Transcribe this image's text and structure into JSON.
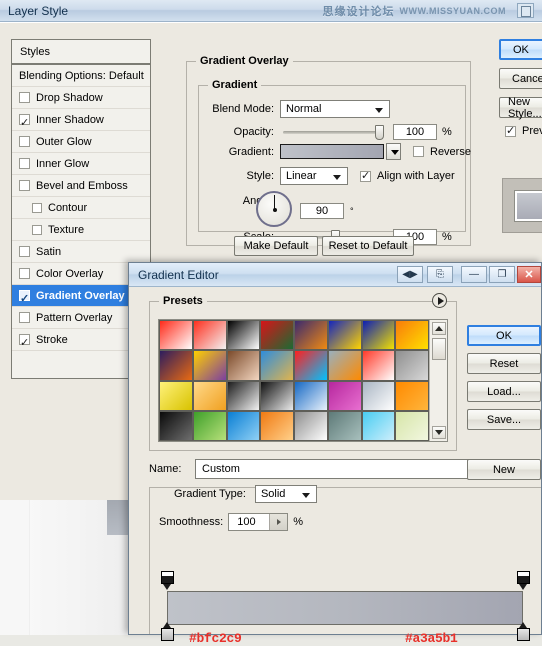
{
  "window": {
    "title": "Layer Style",
    "watermark_cn": "思缘设计论坛",
    "watermark_en": "WWW.MISSYUAN.COM",
    "watermark_icon": "window-icon"
  },
  "styles_panel": {
    "header": "Styles",
    "blending_options": "Blending Options: Default",
    "items": [
      {
        "label": "Drop Shadow",
        "checked": false,
        "indent": false,
        "selected": false
      },
      {
        "label": "Inner Shadow",
        "checked": true,
        "indent": false,
        "selected": false
      },
      {
        "label": "Outer Glow",
        "checked": false,
        "indent": false,
        "selected": false
      },
      {
        "label": "Inner Glow",
        "checked": false,
        "indent": false,
        "selected": false
      },
      {
        "label": "Bevel and Emboss",
        "checked": false,
        "indent": false,
        "selected": false
      },
      {
        "label": "Contour",
        "checked": false,
        "indent": true,
        "selected": false
      },
      {
        "label": "Texture",
        "checked": false,
        "indent": true,
        "selected": false
      },
      {
        "label": "Satin",
        "checked": false,
        "indent": false,
        "selected": false
      },
      {
        "label": "Color Overlay",
        "checked": false,
        "indent": false,
        "selected": false
      },
      {
        "label": "Gradient Overlay",
        "checked": true,
        "indent": false,
        "selected": true
      },
      {
        "label": "Pattern Overlay",
        "checked": false,
        "indent": false,
        "selected": false
      },
      {
        "label": "Stroke",
        "checked": true,
        "indent": false,
        "selected": false
      }
    ]
  },
  "gradient_overlay": {
    "section_title": "Gradient Overlay",
    "group_title": "Gradient",
    "blend_mode_label": "Blend Mode:",
    "blend_mode_value": "Normal",
    "opacity_label": "Opacity:",
    "opacity_value": "100",
    "opacity_unit": "%",
    "gradient_label": "Gradient:",
    "gradient_start": "#bfc2c9",
    "gradient_end": "#a3a5b1",
    "reverse_label": "Reverse",
    "reverse_checked": false,
    "style_label": "Style:",
    "style_value": "Linear",
    "align_label": "Align with Layer",
    "align_checked": true,
    "angle_label": "Angle:",
    "angle_value": "90",
    "angle_unit": "°",
    "scale_label": "Scale:",
    "scale_value": "100",
    "scale_unit": "%",
    "make_default": "Make Default",
    "reset_to_default": "Reset to Default"
  },
  "layer_style_buttons": {
    "ok": "OK",
    "cancel": "Cancel",
    "new_style": "New Style...",
    "preview_label": "Preview",
    "preview_checked": true
  },
  "gradient_editor": {
    "title": "Gradient Editor",
    "controls": {
      "nav": "arrows-icon",
      "restore": "restore-icon",
      "minimize": "minimize-icon",
      "maximize": "maximize-icon",
      "close": "close-icon"
    },
    "presets_label": "Presets",
    "presets_menu": "presets-menu-icon",
    "presets": [
      [
        "#ff2a19",
        "#ffffff"
      ],
      [
        "#ff2f1e",
        "#f2f2f2"
      ],
      [
        "#000000",
        "#ffffff"
      ],
      [
        "#d81418",
        "#1b6b33"
      ],
      [
        "#3b2a6e",
        "#f08a12"
      ],
      [
        "#1526bd",
        "#ffd400"
      ],
      [
        "#0d1fb5",
        "#f2e000"
      ],
      [
        "#f97c0a",
        "#ffe000"
      ],
      [
        "#2d1d5e",
        "#e86a12"
      ],
      [
        "#ffd000",
        "#7c3fa0"
      ],
      [
        "#7b4a2a",
        "#f3d6c0"
      ],
      [
        "#2e8ddd",
        "#e0b44e"
      ],
      [
        "#ff1f1f",
        "#00c2ff"
      ],
      [
        "#9ab0bd",
        "#ff8a00"
      ],
      [
        "#ff3a2a",
        "#ffffff"
      ],
      [
        "#8f8f8f",
        "#d8d8d8"
      ],
      [
        "#fff27a",
        "#d8c200"
      ],
      [
        "#ffd98a",
        "#f0a020"
      ],
      [
        "#1d1d1d",
        "#f2f2f2"
      ],
      [
        "#111111",
        "#eaeaea"
      ],
      [
        "#1769c4",
        "#e8f1fb"
      ],
      [
        "#b6279e",
        "#e86fd0"
      ],
      [
        "#aab6c4",
        "#ffffff"
      ],
      [
        "#ff8a00",
        "#ffb53c"
      ],
      [
        "#0a0a0a",
        "#6e6e6e"
      ],
      [
        "#3fa02a",
        "#b7e07a"
      ],
      [
        "#0a7fd4",
        "#8fd0f5"
      ],
      [
        "#f07a12",
        "#ffd08a"
      ],
      [
        "#8e8e8e",
        "#ffffff"
      ],
      [
        "#5e7a78",
        "#a8c0bd"
      ],
      [
        "#49cdf2",
        "#cdeefb"
      ],
      [
        "#d6e5a8",
        "#f2f7e0"
      ]
    ],
    "name_label": "Name:",
    "name_value": "Custom",
    "new_button": "New",
    "gradient_type_label": "Gradient Type:",
    "gradient_type_value": "Solid",
    "smoothness_label": "Smoothness:",
    "smoothness_value": "100",
    "smoothness_unit": "%",
    "stop_left_hex": "#bfc2c9",
    "stop_right_hex": "#a3a5b1",
    "buttons": {
      "ok": "OK",
      "reset": "Reset",
      "load": "Load...",
      "save": "Save..."
    }
  }
}
